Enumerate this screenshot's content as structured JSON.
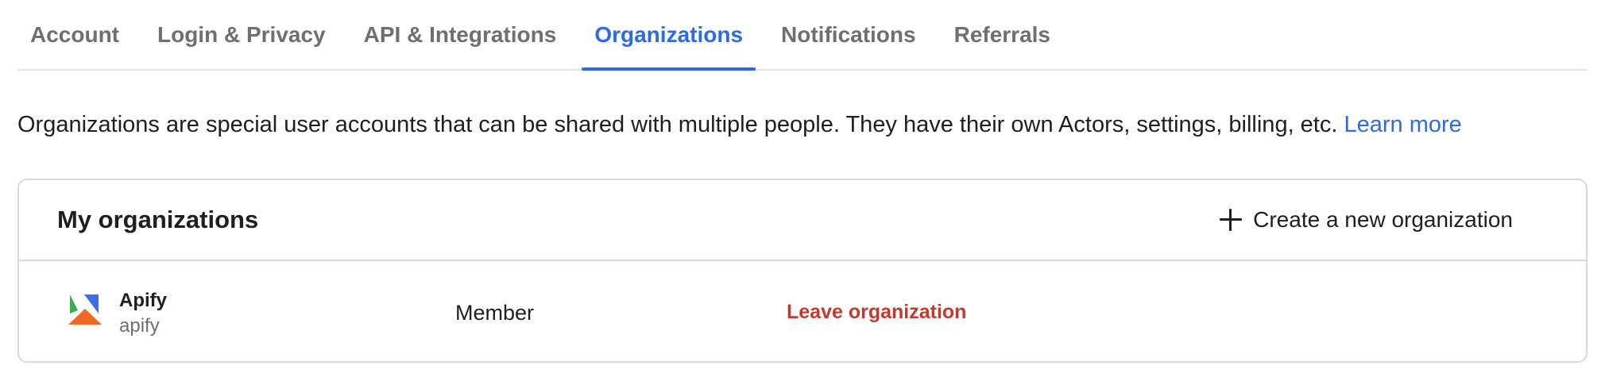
{
  "tabs": [
    {
      "label": "Account"
    },
    {
      "label": "Login & Privacy"
    },
    {
      "label": "API & Integrations"
    },
    {
      "label": "Organizations",
      "active": true
    },
    {
      "label": "Notifications"
    },
    {
      "label": "Referrals"
    }
  ],
  "intro": {
    "text": "Organizations are special user accounts that can be shared with multiple people. They have their own Actors, settings, billing, etc. ",
    "link": "Learn more"
  },
  "card": {
    "title": "My organizations",
    "create_label": "Create a new organization",
    "rows": [
      {
        "name": "Apify",
        "slug": "apify",
        "role": "Member",
        "action": "Leave organization"
      }
    ]
  },
  "colors": {
    "accent": "#2d6be6",
    "danger": "#c7382c",
    "logo_green": "#3eaa4f",
    "logo_blue": "#3b6fe6",
    "logo_orange": "#f06a24"
  }
}
